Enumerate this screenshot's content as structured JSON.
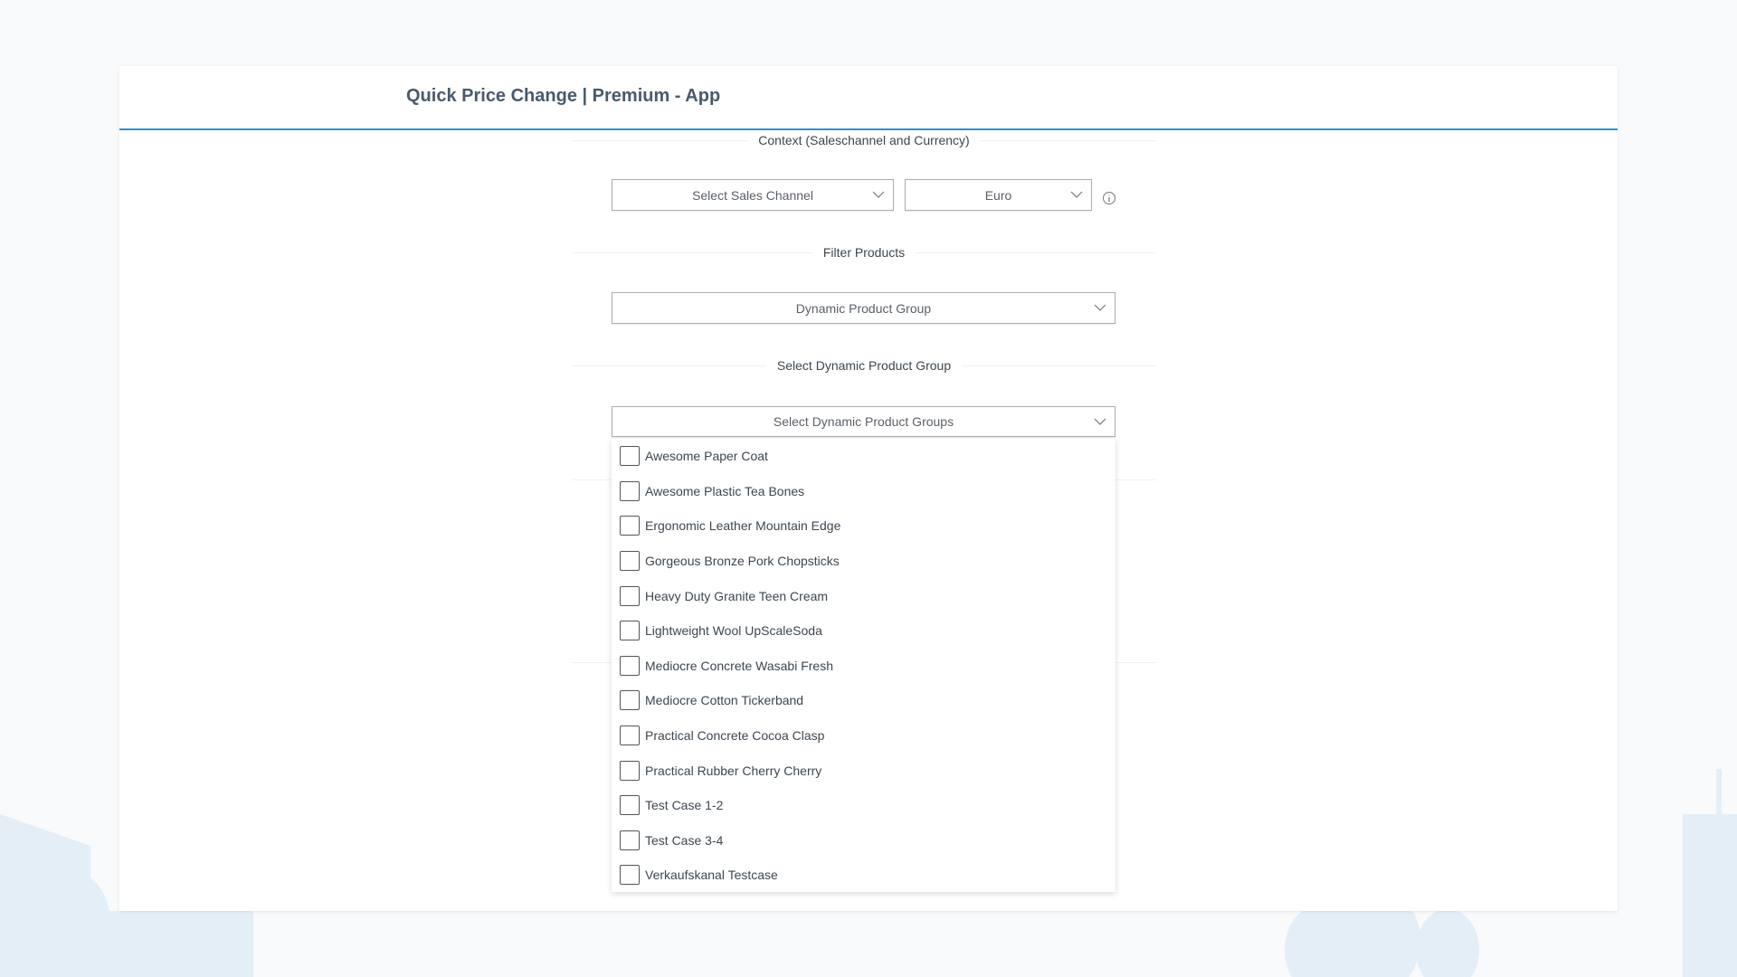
{
  "header": {
    "title": "Quick Price Change | Premium - App"
  },
  "context": {
    "label": "Context (Saleschannel and Currency)",
    "sales_channel_placeholder": "Select Sales Channel",
    "currency": "Euro",
    "info_icon": "info-icon"
  },
  "filter": {
    "label": "Filter Products",
    "value": "Dynamic Product Group"
  },
  "group_select": {
    "label": "Select Dynamic Product Group",
    "placeholder": "Select Dynamic Product Groups",
    "options": [
      "Awesome Paper Coat",
      "Awesome Plastic Tea Bones",
      "Ergonomic Leather Mountain Edge",
      "Gorgeous Bronze Pork Chopsticks",
      "Heavy Duty Granite Teen Cream",
      "Lightweight Wool UpScaleSoda",
      "Mediocre Concrete Wasabi Fresh",
      "Mediocre Cotton Tickerband",
      "Practical Concrete Cocoa Clasp",
      "Practical Rubber Cherry Cherry",
      "Test Case 1-2",
      "Test Case 3-4",
      "Verkaufskanal Testcase"
    ]
  },
  "colors": {
    "accent": "#2d8ed6",
    "tree": "#d6e6f3"
  }
}
